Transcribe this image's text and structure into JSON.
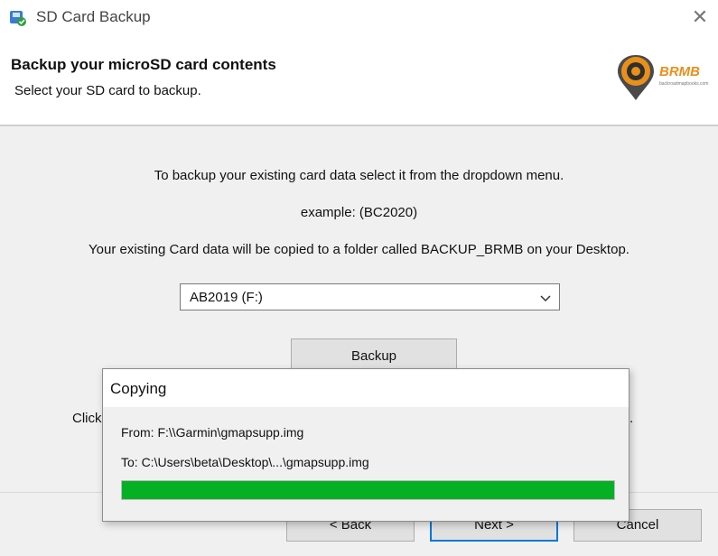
{
  "window": {
    "title": "SD Card Backup",
    "close_glyph": "✕"
  },
  "header": {
    "title": "Backup your microSD card contents",
    "subtitle": "Select your SD card to backup.",
    "logo_text": "BRMB",
    "logo_tagline": "backroadmapbooks.com"
  },
  "body": {
    "instruction": "To backup your existing card data select it from the dropdown menu.",
    "example": "example: (BC2020)",
    "note": "Your existing Card data will be copied to a folder called BACKUP_BRMB on your Desktop.",
    "dropdown_value": "AB2019 (F:)",
    "backup_label": "Backup",
    "click_text_start": "Click",
    "click_text_end": "."
  },
  "footer": {
    "back_label": "< Back",
    "next_label": "Next >",
    "cancel_label": "Cancel"
  },
  "copy_dialog": {
    "title": "Copying",
    "from": "From: F:\\\\Garmin\\gmapsupp.img",
    "to": "To: C:\\Users\\beta\\Desktop\\...\\gmapsupp.img",
    "progress_fraction": 1.0
  },
  "colors": {
    "accent": "#0078d7",
    "progress": "#06b025",
    "logo_orange": "#e8901a"
  },
  "icons": {
    "app": "sd-card-backup-icon",
    "close": "close-icon",
    "dropdown": "chevron-down-icon"
  }
}
